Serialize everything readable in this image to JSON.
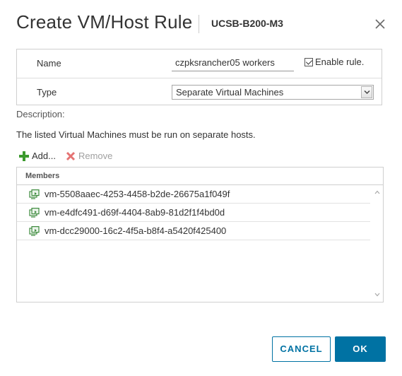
{
  "dialog": {
    "title": "Create VM/Host Rule",
    "subtitle": "UCSB-B200-M3"
  },
  "form": {
    "name_label": "Name",
    "name_value": "czpksrancher05 workers",
    "enable_label": "Enable rule.",
    "enable_checked": true,
    "type_label": "Type",
    "type_selected": "Separate Virtual Machines"
  },
  "description": {
    "label": "Description:",
    "text": "The listed Virtual Machines must be run on separate hosts."
  },
  "toolbar": {
    "add_label": "Add...",
    "remove_label": "Remove"
  },
  "members": {
    "header": "Members",
    "items": [
      "vm-5508aaec-4253-4458-b2de-26675a1f049f",
      "vm-e4dfc491-d69f-4404-8ab9-81d2f1f4bd0d",
      "vm-dcc29000-16c2-4f5a-b8f4-a5420f425400"
    ]
  },
  "footer": {
    "cancel_label": "CANCEL",
    "ok_label": "OK"
  },
  "colors": {
    "accent": "#0072a3",
    "add_icon": "#3c9a2e",
    "remove_icon": "#e57373"
  }
}
